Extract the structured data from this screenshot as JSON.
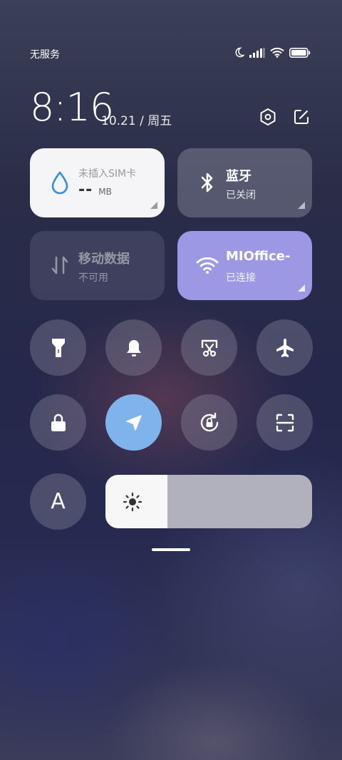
{
  "status_bar": {
    "carrier": "无服务",
    "icons": [
      "moon-icon",
      "signal-icon",
      "wifi-icon",
      "battery-icon"
    ]
  },
  "header": {
    "time": "8:16",
    "date": "10.21 / 周五",
    "settings_icon": "hexagon-settings-icon",
    "edit_icon": "edit-icon"
  },
  "tiles": {
    "data_usage": {
      "title": "未插入SIM卡",
      "value": "--",
      "unit": "MB",
      "icon": "water-drop-icon"
    },
    "bluetooth": {
      "title": "蓝牙",
      "status": "已关闭",
      "icon": "bluetooth-icon"
    },
    "mobile_data": {
      "title": "移动数据",
      "status": "不可用",
      "icon": "mobile-data-arrows-icon"
    },
    "wifi": {
      "title": "MIOffice-",
      "status": "已连接",
      "icon": "wifi-icon"
    }
  },
  "toggles_row1": [
    "flashlight-icon",
    "bell-icon",
    "screenshot-icon",
    "airplane-icon"
  ],
  "toggles_row2": [
    "lock-icon",
    "location-icon",
    "rotation-lock-icon",
    "scan-icon"
  ],
  "bottom_row": {
    "auto_brightness_label": "A",
    "brightness": {
      "icon": "sun-icon",
      "level": 0.3
    }
  },
  "colors": {
    "accent_blue": "#7fb3ec",
    "wifi_tile": "#9e99e6",
    "data_tile": "#f5f5f5",
    "bt_tile": "rgba(200,200,215,0.28)",
    "mobile_tile": "rgba(150,150,175,0.2)"
  }
}
